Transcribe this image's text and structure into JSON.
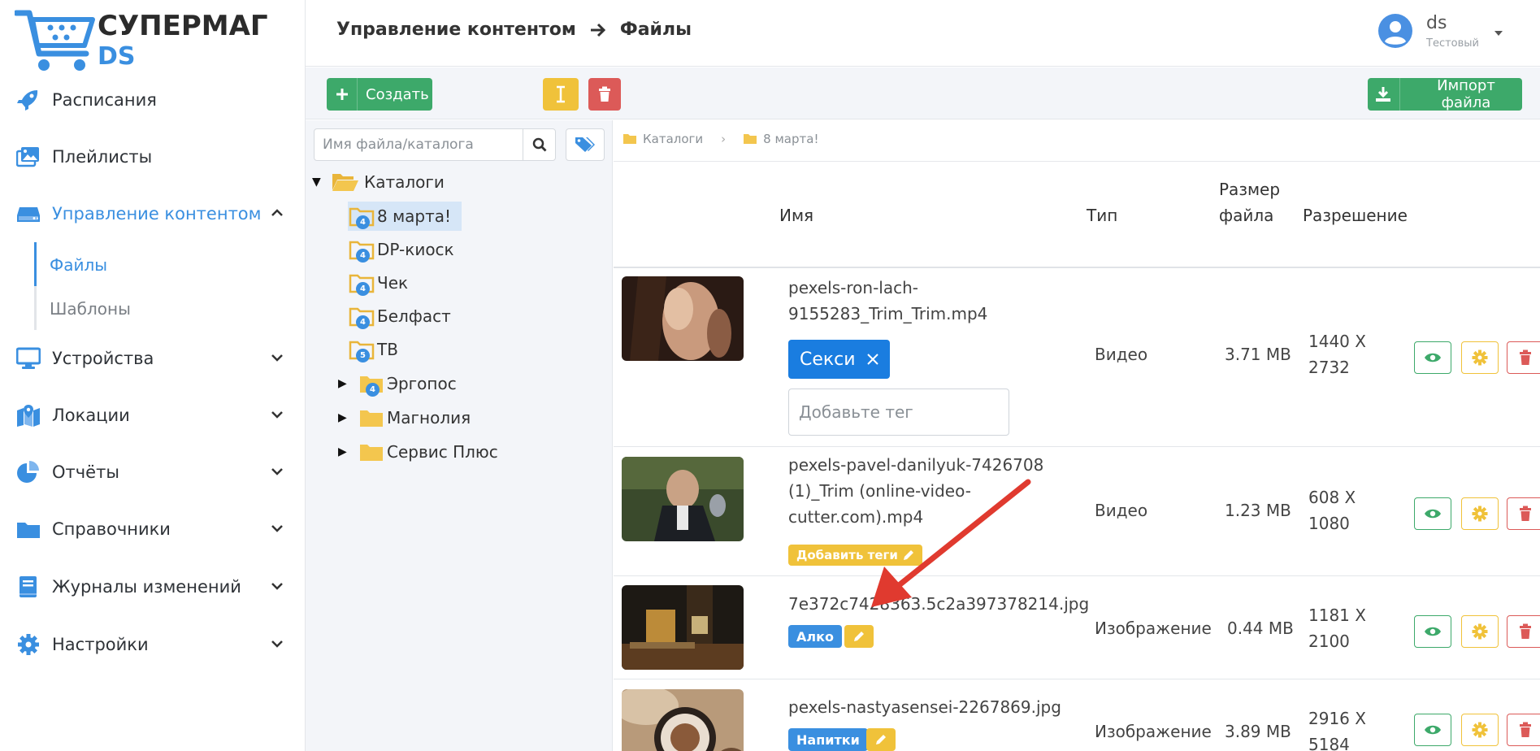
{
  "logo": {
    "line1": "СУПЕРМАГ",
    "line2": "DS"
  },
  "sidebar": {
    "items": [
      {
        "label": "Расписания",
        "icon": "rocket-icon"
      },
      {
        "label": "Плейлисты",
        "icon": "images-icon"
      },
      {
        "label": "Управление контентом",
        "icon": "hdd-icon",
        "active": true
      },
      {
        "label": "Устройства",
        "icon": "monitor-icon"
      },
      {
        "label": "Локации",
        "icon": "map-icon"
      },
      {
        "label": "Отчёты",
        "icon": "pie-chart-icon"
      },
      {
        "label": "Справочники",
        "icon": "folder-icon"
      },
      {
        "label": "Журналы изменений",
        "icon": "book-icon"
      },
      {
        "label": "Настройки",
        "icon": "gear-icon"
      }
    ],
    "subitems": [
      {
        "label": "Файлы",
        "active": true
      },
      {
        "label": "Шаблоны"
      }
    ]
  },
  "header": {
    "crumb1": "Управление контентом",
    "crumb2": "Файлы",
    "user": {
      "name": "ds",
      "role": "Тестовый"
    }
  },
  "toolbar": {
    "create_label": "Создать",
    "import_label": "Импорт файла"
  },
  "tree": {
    "search_placeholder": "Имя файла/каталога",
    "root": "Каталоги",
    "children": [
      {
        "label": "8 марта!",
        "badge": "4"
      },
      {
        "label": "DP-киоск",
        "badge": "4"
      },
      {
        "label": "Чек",
        "badge": "4"
      },
      {
        "label": "Белфаст",
        "badge": "4"
      },
      {
        "label": "ТВ",
        "badge": "5"
      },
      {
        "label": "Эргопос",
        "badge": "4"
      },
      {
        "label": "Магнолия",
        "badge": ""
      },
      {
        "label": "Сервис Плюс",
        "badge": ""
      }
    ]
  },
  "main": {
    "breadcrumb": [
      "Каталоги",
      "8 марта!"
    ],
    "columns": {
      "name": "Имя",
      "type": "Тип",
      "size_line1": "Размер",
      "size_line2": "файла",
      "resolution": "Разрешение"
    },
    "rows": [
      {
        "name_l1": "pexels-ron-lach-",
        "name_l2": "9155283_Trim_Trim.mp4",
        "tag": "Секси",
        "tag_placeholder": "Добавьте тег",
        "type": "Видео",
        "size": "3.71 MB",
        "res_l1": "1440 X",
        "res_l2": "2732"
      },
      {
        "name_l1": "pexels-pavel-danilyuk-7426708",
        "name_l2": "(1)_Trim (online-video-",
        "name_l3": "cutter.com).mp4",
        "add_tags": "Добавить теги",
        "type": "Видео",
        "size": "1.23 MB",
        "res_l1": "608 X",
        "res_l2": "1080"
      },
      {
        "name_l1": "7e372c7428363.5c2a397378214.jpg",
        "tag": "Алко",
        "type": "Изображение",
        "size": "0.44 MB",
        "res_l1": "1181 X",
        "res_l2": "2100"
      },
      {
        "name_l1": "pexels-nastyasensei-2267869.jpg",
        "tag": "Напитки",
        "type": "Изображение",
        "size": "3.89 MB",
        "res_l1": "2916 X",
        "res_l2": "5184"
      }
    ]
  },
  "colors": {
    "accent": "#3a8fe0",
    "green": "#3da96a",
    "yellow": "#f0c23a",
    "red": "#dc5a58",
    "arrow": "#e03a2f"
  }
}
